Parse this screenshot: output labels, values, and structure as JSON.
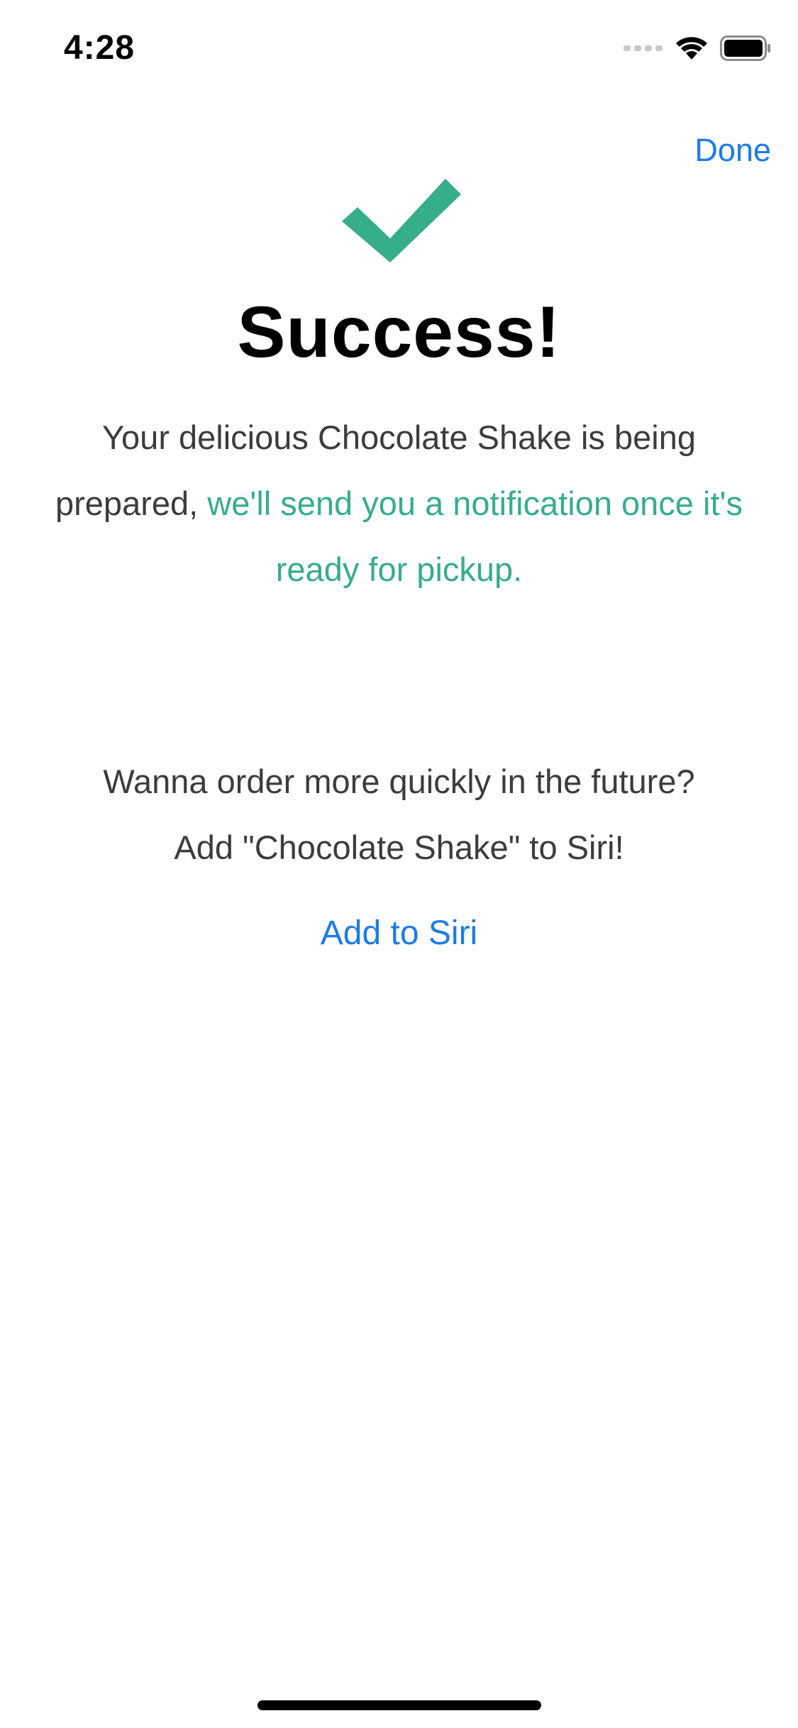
{
  "status_bar": {
    "time": "4:28",
    "icons": [
      "signal-dots-icon",
      "wifi-icon",
      "battery-icon"
    ]
  },
  "nav": {
    "done_label": "Done"
  },
  "success": {
    "icon": "checkmark-icon",
    "title": "Success!",
    "message_plain": "Your delicious Chocolate Shake is being prepared, ",
    "message_highlight": "we'll send you a notification once it's ready for pickup."
  },
  "siri": {
    "prompt_line1": "Wanna order more quickly in the future?",
    "prompt_line2": "Add \"Chocolate Shake\" to Siri!",
    "button_label": "Add to Siri"
  },
  "colors": {
    "accent_green": "#36ad8b",
    "link_blue": "#1b7ce8"
  }
}
